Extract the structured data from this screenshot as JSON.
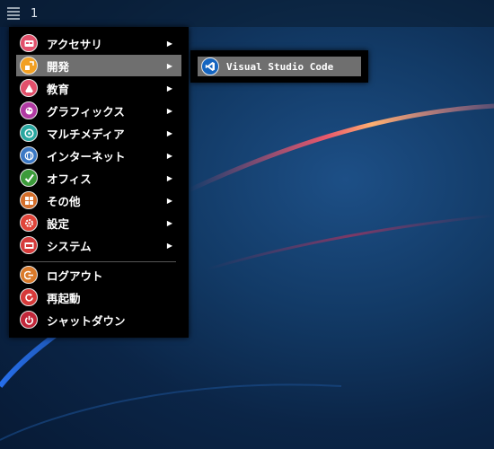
{
  "topbar": {
    "workspace": "1"
  },
  "menu": {
    "items": [
      {
        "label": "アクセサリ",
        "icon": "accessories-icon",
        "color": "#e2506b",
        "submenu": true
      },
      {
        "label": "開発",
        "icon": "development-icon",
        "color": "#f2a023",
        "submenu": true,
        "active": true
      },
      {
        "label": "教育",
        "icon": "education-icon",
        "color": "#e2506b",
        "submenu": true
      },
      {
        "label": "グラフィックス",
        "icon": "graphics-icon",
        "color": "#b13aa3",
        "submenu": true
      },
      {
        "label": "マルチメディア",
        "icon": "multimedia-icon",
        "color": "#29a7a0",
        "submenu": true
      },
      {
        "label": "インターネット",
        "icon": "internet-icon",
        "color": "#3b78c4",
        "submenu": true
      },
      {
        "label": "オフィス",
        "icon": "office-icon",
        "color": "#3c9b3a",
        "submenu": true
      },
      {
        "label": "その他",
        "icon": "other-icon",
        "color": "#d46e2a",
        "submenu": true
      },
      {
        "label": "設定",
        "icon": "settings-icon",
        "color": "#e0453a",
        "submenu": true
      },
      {
        "label": "システム",
        "icon": "system-icon",
        "color": "#d63a3a",
        "submenu": true
      }
    ],
    "actions": [
      {
        "label": "ログアウト",
        "icon": "logout-icon",
        "color": "#d9792a"
      },
      {
        "label": "再起動",
        "icon": "reboot-icon",
        "color": "#d63a3a"
      },
      {
        "label": "シャットダウン",
        "icon": "shutdown-icon",
        "color": "#c2273a"
      }
    ]
  },
  "submenu": {
    "items": [
      {
        "label": "Visual Studio Code",
        "icon": "vscode-icon",
        "color": "#1565c0"
      }
    ]
  }
}
